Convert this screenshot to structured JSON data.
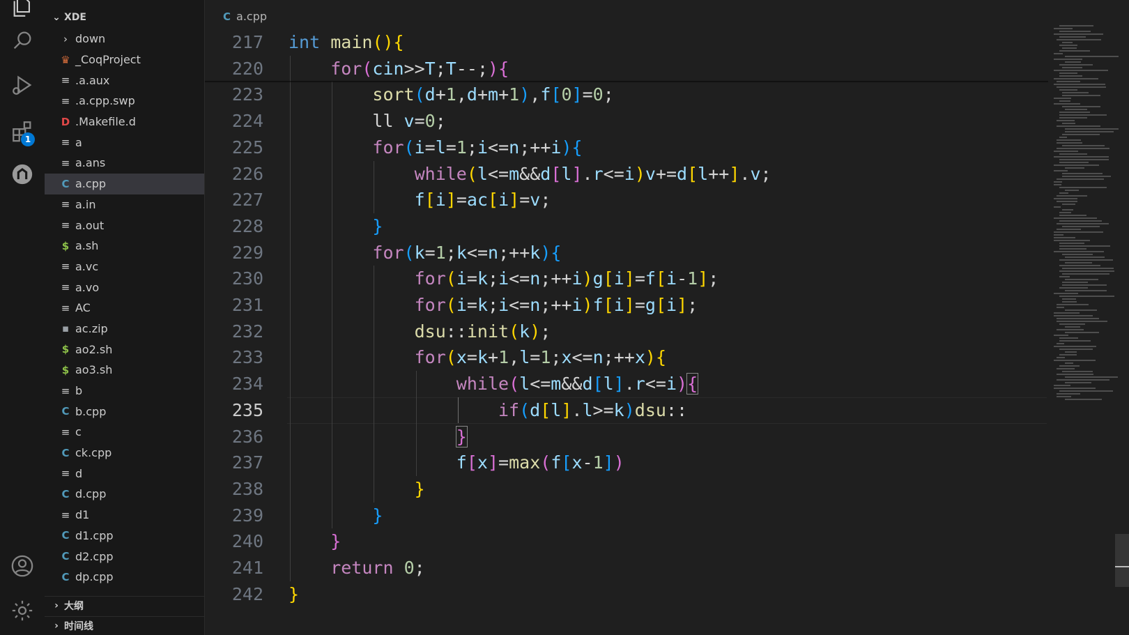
{
  "explorer": {
    "root_label": "XDE",
    "files": [
      {
        "name": "down",
        "icon": "folder-chevron-icon"
      },
      {
        "name": "_CoqProject",
        "icon": "coq-icon"
      },
      {
        "name": ".a.aux",
        "icon": "text-file-icon"
      },
      {
        "name": ".a.cpp.swp",
        "icon": "text-file-icon"
      },
      {
        "name": ".Makefile.d",
        "icon": "d-file-icon"
      },
      {
        "name": "a",
        "icon": "text-file-icon"
      },
      {
        "name": "a.ans",
        "icon": "text-file-icon"
      },
      {
        "name": "a.cpp",
        "icon": "cpp-file-icon",
        "selected": true
      },
      {
        "name": "a.in",
        "icon": "text-file-icon"
      },
      {
        "name": "a.out",
        "icon": "text-file-icon"
      },
      {
        "name": "a.sh",
        "icon": "shell-file-icon"
      },
      {
        "name": "a.vc",
        "icon": "text-file-icon"
      },
      {
        "name": "a.vo",
        "icon": "text-file-icon"
      },
      {
        "name": "AC",
        "icon": "text-file-icon"
      },
      {
        "name": "ac.zip",
        "icon": "zip-file-icon"
      },
      {
        "name": "ao2.sh",
        "icon": "shell-file-icon"
      },
      {
        "name": "ao3.sh",
        "icon": "shell-file-icon"
      },
      {
        "name": "b",
        "icon": "text-file-icon"
      },
      {
        "name": "b.cpp",
        "icon": "cpp-file-icon"
      },
      {
        "name": "c",
        "icon": "text-file-icon"
      },
      {
        "name": "ck.cpp",
        "icon": "cpp-file-icon"
      },
      {
        "name": "d",
        "icon": "text-file-icon"
      },
      {
        "name": "d.cpp",
        "icon": "cpp-file-icon"
      },
      {
        "name": "d1",
        "icon": "text-file-icon"
      },
      {
        "name": "d1.cpp",
        "icon": "cpp-file-icon"
      },
      {
        "name": "d2.cpp",
        "icon": "cpp-file-icon"
      },
      {
        "name": "dp.cpp",
        "icon": "cpp-file-icon"
      }
    ],
    "outline_label": "大纲",
    "timeline_label": "时间线"
  },
  "activity_bar": {
    "extensions_badge": "1",
    "icons": [
      "explorer-icon",
      "search-icon",
      "run-debug-icon",
      "extensions-icon",
      "remote-icon",
      "account-icon",
      "settings-gear-icon"
    ]
  },
  "editor": {
    "breadcrumb_file": "a.cpp",
    "active_line": "235",
    "lines": [
      {
        "n": "217",
        "indent": 0,
        "tokens": [
          [
            "kw",
            "int"
          ],
          [
            "op",
            " "
          ],
          [
            "fn",
            "main"
          ],
          [
            "p1",
            "()"
          ],
          [
            "p1",
            "{"
          ]
        ]
      },
      {
        "n": "220",
        "indent": 1,
        "tokens": [
          [
            "ctl",
            "for"
          ],
          [
            "p2",
            "("
          ],
          [
            "var",
            "cin"
          ],
          [
            "op",
            ">>"
          ],
          [
            "var",
            "T"
          ],
          [
            "op",
            ";"
          ],
          [
            "var",
            "T"
          ],
          [
            "op",
            "--;"
          ],
          [
            "p2",
            ")"
          ],
          [
            "p2",
            "{"
          ]
        ]
      },
      {
        "n": "223",
        "indent": 2,
        "tokens": [
          [
            "fn",
            "sort"
          ],
          [
            "p3",
            "("
          ],
          [
            "var",
            "d"
          ],
          [
            "op",
            "+"
          ],
          [
            "num",
            "1"
          ],
          [
            "op",
            ","
          ],
          [
            "var",
            "d"
          ],
          [
            "op",
            "+"
          ],
          [
            "var",
            "m"
          ],
          [
            "op",
            "+"
          ],
          [
            "num",
            "1"
          ],
          [
            "p3",
            ")"
          ],
          [
            "op",
            ","
          ],
          [
            "var",
            "f"
          ],
          [
            "p3",
            "["
          ],
          [
            "num",
            "0"
          ],
          [
            "p3",
            "]"
          ],
          [
            "op",
            "="
          ],
          [
            "num",
            "0"
          ],
          [
            "op",
            ";"
          ]
        ]
      },
      {
        "n": "224",
        "indent": 2,
        "tokens": [
          [
            "op",
            "ll "
          ],
          [
            "var",
            "v"
          ],
          [
            "op",
            "="
          ],
          [
            "num",
            "0"
          ],
          [
            "op",
            ";"
          ]
        ]
      },
      {
        "n": "225",
        "indent": 2,
        "tokens": [
          [
            "ctl",
            "for"
          ],
          [
            "p3",
            "("
          ],
          [
            "var",
            "i"
          ],
          [
            "op",
            "="
          ],
          [
            "var",
            "l"
          ],
          [
            "op",
            "="
          ],
          [
            "num",
            "1"
          ],
          [
            "op",
            ";"
          ],
          [
            "var",
            "i"
          ],
          [
            "op",
            "<="
          ],
          [
            "var",
            "n"
          ],
          [
            "op",
            ";++"
          ],
          [
            "var",
            "i"
          ],
          [
            "p3",
            ")"
          ],
          [
            "p3",
            "{"
          ]
        ]
      },
      {
        "n": "226",
        "indent": 3,
        "tokens": [
          [
            "ctl",
            "while"
          ],
          [
            "p1",
            "("
          ],
          [
            "var",
            "l"
          ],
          [
            "op",
            "<="
          ],
          [
            "var",
            "m"
          ],
          [
            "op",
            "&&"
          ],
          [
            "var",
            "d"
          ],
          [
            "p2",
            "["
          ],
          [
            "var",
            "l"
          ],
          [
            "p2",
            "]"
          ],
          [
            "op",
            "."
          ],
          [
            "var",
            "r"
          ],
          [
            "op",
            "<="
          ],
          [
            "var",
            "i"
          ],
          [
            "p1",
            ")"
          ],
          [
            "var",
            "v"
          ],
          [
            "op",
            "+="
          ],
          [
            "var",
            "d"
          ],
          [
            "p1",
            "["
          ],
          [
            "var",
            "l"
          ],
          [
            "op",
            "++"
          ],
          [
            "p1",
            "]"
          ],
          [
            "op",
            "."
          ],
          [
            "var",
            "v"
          ],
          [
            "op",
            ";"
          ]
        ]
      },
      {
        "n": "227",
        "indent": 3,
        "tokens": [
          [
            "var",
            "f"
          ],
          [
            "p1",
            "["
          ],
          [
            "var",
            "i"
          ],
          [
            "p1",
            "]"
          ],
          [
            "op",
            "="
          ],
          [
            "var",
            "ac"
          ],
          [
            "p1",
            "["
          ],
          [
            "var",
            "i"
          ],
          [
            "p1",
            "]"
          ],
          [
            "op",
            "="
          ],
          [
            "var",
            "v"
          ],
          [
            "op",
            ";"
          ]
        ]
      },
      {
        "n": "228",
        "indent": 2,
        "tokens": [
          [
            "p3",
            "}"
          ]
        ]
      },
      {
        "n": "229",
        "indent": 2,
        "tokens": [
          [
            "ctl",
            "for"
          ],
          [
            "p3",
            "("
          ],
          [
            "var",
            "k"
          ],
          [
            "op",
            "="
          ],
          [
            "num",
            "1"
          ],
          [
            "op",
            ";"
          ],
          [
            "var",
            "k"
          ],
          [
            "op",
            "<="
          ],
          [
            "var",
            "n"
          ],
          [
            "op",
            ";++"
          ],
          [
            "var",
            "k"
          ],
          [
            "p3",
            ")"
          ],
          [
            "p3",
            "{"
          ]
        ]
      },
      {
        "n": "230",
        "indent": 3,
        "tokens": [
          [
            "ctl",
            "for"
          ],
          [
            "p1",
            "("
          ],
          [
            "var",
            "i"
          ],
          [
            "op",
            "="
          ],
          [
            "var",
            "k"
          ],
          [
            "op",
            ";"
          ],
          [
            "var",
            "i"
          ],
          [
            "op",
            "<="
          ],
          [
            "var",
            "n"
          ],
          [
            "op",
            ";++"
          ],
          [
            "var",
            "i"
          ],
          [
            "p1",
            ")"
          ],
          [
            "var",
            "g"
          ],
          [
            "p1",
            "["
          ],
          [
            "var",
            "i"
          ],
          [
            "p1",
            "]"
          ],
          [
            "op",
            "="
          ],
          [
            "var",
            "f"
          ],
          [
            "p1",
            "["
          ],
          [
            "var",
            "i"
          ],
          [
            "op",
            "-"
          ],
          [
            "num",
            "1"
          ],
          [
            "p1",
            "]"
          ],
          [
            "op",
            ";"
          ]
        ]
      },
      {
        "n": "231",
        "indent": 3,
        "tokens": [
          [
            "ctl",
            "for"
          ],
          [
            "p1",
            "("
          ],
          [
            "var",
            "i"
          ],
          [
            "op",
            "="
          ],
          [
            "var",
            "k"
          ],
          [
            "op",
            ";"
          ],
          [
            "var",
            "i"
          ],
          [
            "op",
            "<="
          ],
          [
            "var",
            "n"
          ],
          [
            "op",
            ";++"
          ],
          [
            "var",
            "i"
          ],
          [
            "p1",
            ")"
          ],
          [
            "var",
            "f"
          ],
          [
            "p1",
            "["
          ],
          [
            "var",
            "i"
          ],
          [
            "p1",
            "]"
          ],
          [
            "op",
            "="
          ],
          [
            "var",
            "g"
          ],
          [
            "p1",
            "["
          ],
          [
            "var",
            "i"
          ],
          [
            "p1",
            "]"
          ],
          [
            "op",
            ";"
          ]
        ]
      },
      {
        "n": "232",
        "indent": 3,
        "tokens": [
          [
            "fn",
            "dsu"
          ],
          [
            "op",
            "::"
          ],
          [
            "fn",
            "init"
          ],
          [
            "p1",
            "("
          ],
          [
            "var",
            "k"
          ],
          [
            "p1",
            ")"
          ],
          [
            "op",
            ";"
          ]
        ]
      },
      {
        "n": "233",
        "indent": 3,
        "tokens": [
          [
            "ctl",
            "for"
          ],
          [
            "p1",
            "("
          ],
          [
            "var",
            "x"
          ],
          [
            "op",
            "="
          ],
          [
            "var",
            "k"
          ],
          [
            "op",
            "+"
          ],
          [
            "num",
            "1"
          ],
          [
            "op",
            ","
          ],
          [
            "var",
            "l"
          ],
          [
            "op",
            "="
          ],
          [
            "num",
            "1"
          ],
          [
            "op",
            ";"
          ],
          [
            "var",
            "x"
          ],
          [
            "op",
            "<="
          ],
          [
            "var",
            "n"
          ],
          [
            "op",
            ";++"
          ],
          [
            "var",
            "x"
          ],
          [
            "p1",
            ")"
          ],
          [
            "p1",
            "{"
          ]
        ]
      },
      {
        "n": "234",
        "indent": 4,
        "tokens": [
          [
            "ctl",
            "while"
          ],
          [
            "p2",
            "("
          ],
          [
            "var",
            "l"
          ],
          [
            "op",
            "<="
          ],
          [
            "var",
            "m"
          ],
          [
            "op",
            "&&"
          ],
          [
            "var",
            "d"
          ],
          [
            "p3",
            "["
          ],
          [
            "var",
            "l"
          ],
          [
            "p3",
            "]"
          ],
          [
            "op",
            "."
          ],
          [
            "var",
            "r"
          ],
          [
            "op",
            "<="
          ],
          [
            "var",
            "i"
          ],
          [
            "p2",
            ")"
          ],
          [
            "p2box",
            "{"
          ]
        ]
      },
      {
        "n": "235",
        "indent": 5,
        "tokens": [
          [
            "ctl",
            "if"
          ],
          [
            "p3",
            "("
          ],
          [
            "var",
            "d"
          ],
          [
            "p1",
            "["
          ],
          [
            "var",
            "l"
          ],
          [
            "p1",
            "]"
          ],
          [
            "op",
            "."
          ],
          [
            "var",
            "l"
          ],
          [
            "op",
            ">="
          ],
          [
            "var",
            "k"
          ],
          [
            "p3",
            ")"
          ],
          [
            "fn",
            "dsu"
          ],
          [
            "op",
            "::"
          ]
        ]
      },
      {
        "n": "236",
        "indent": 4,
        "tokens": [
          [
            "p2box",
            "}"
          ]
        ]
      },
      {
        "n": "237",
        "indent": 4,
        "tokens": [
          [
            "var",
            "f"
          ],
          [
            "p2",
            "["
          ],
          [
            "var",
            "x"
          ],
          [
            "p2",
            "]"
          ],
          [
            "op",
            "="
          ],
          [
            "fn",
            "max"
          ],
          [
            "p2",
            "("
          ],
          [
            "var",
            "f"
          ],
          [
            "p3",
            "["
          ],
          [
            "var",
            "x"
          ],
          [
            "op",
            "-"
          ],
          [
            "num",
            "1"
          ],
          [
            "p3",
            "]"
          ],
          [
            "p2",
            ")"
          ]
        ]
      },
      {
        "n": "238",
        "indent": 3,
        "tokens": [
          [
            "p1",
            "}"
          ]
        ]
      },
      {
        "n": "239",
        "indent": 2,
        "tokens": [
          [
            "p3",
            "}"
          ]
        ]
      },
      {
        "n": "240",
        "indent": 1,
        "tokens": [
          [
            "p2",
            "}"
          ]
        ]
      },
      {
        "n": "241",
        "indent": 1,
        "tokens": [
          [
            "ctl",
            "return"
          ],
          [
            "op",
            " "
          ],
          [
            "num",
            "0"
          ],
          [
            "op",
            ";"
          ]
        ]
      },
      {
        "n": "242",
        "indent": 0,
        "tokens": [
          [
            "p1",
            "}"
          ]
        ]
      }
    ]
  }
}
